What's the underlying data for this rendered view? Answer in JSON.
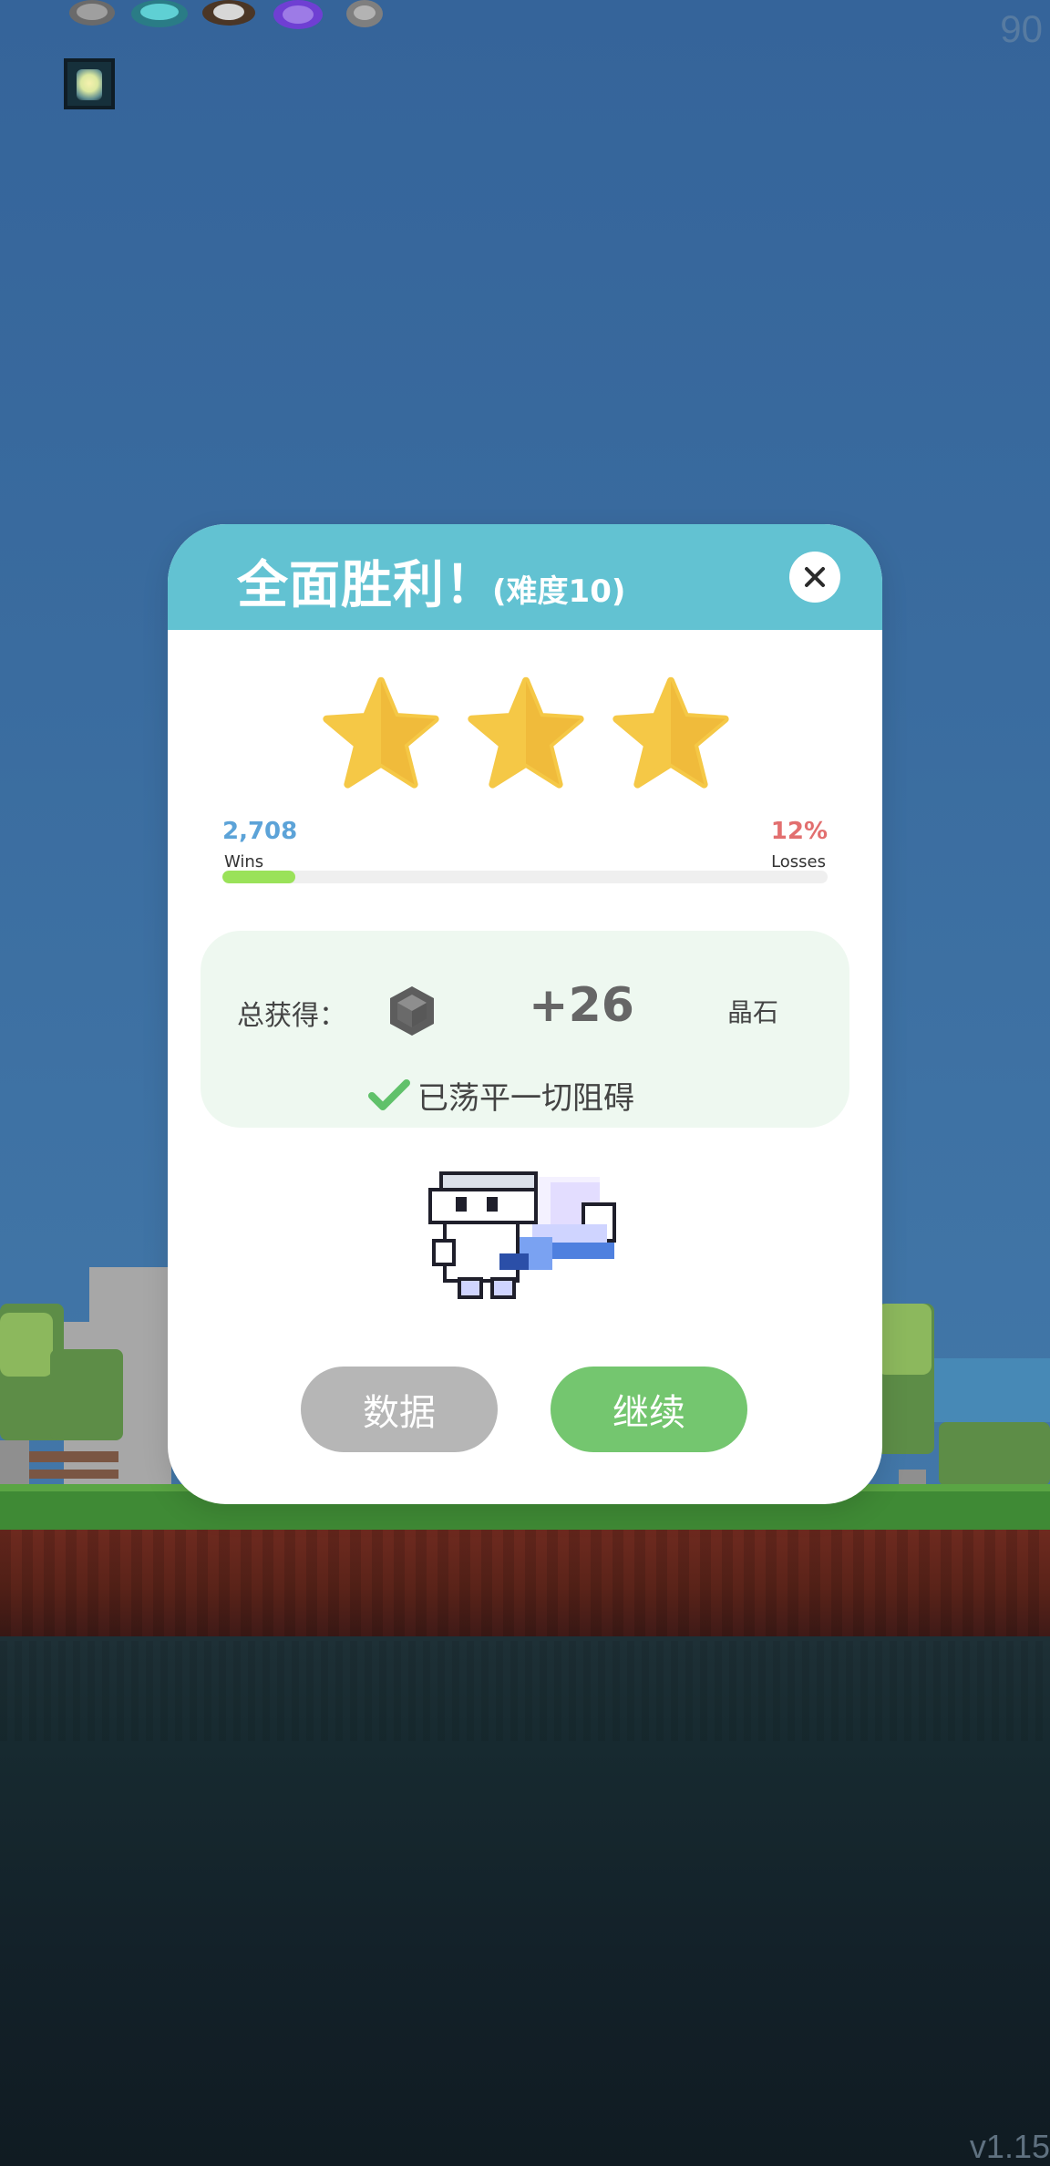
{
  "hud": {
    "fps": "90",
    "version": "v1.15",
    "top_icons": [
      "helmet-icon",
      "shield-icon",
      "boot-icon",
      "potion-icon",
      "lamp-icon"
    ],
    "tile_icon": "lantern-icon"
  },
  "modal": {
    "title": "全面胜利！",
    "difficulty": "(难度10)",
    "stars": 3,
    "stats": {
      "wins_count": "2,708",
      "wins_label": "Wins",
      "loss_percent": "12%",
      "loss_label": "Losses",
      "progress_fraction": 0.12
    },
    "reward": {
      "label": "总获得：",
      "value": "+26",
      "unit": "晶石",
      "icon": "gem-icon"
    },
    "clear_message": "已荡平一切阻碍",
    "buttons": {
      "stats": "数据",
      "continue": "继续"
    },
    "colors": {
      "header": "#62c2d2",
      "stats_button": "#b6b6b6",
      "continue_button": "#74c66f",
      "star": "#f5c846",
      "wins": "#5ca3d8",
      "losses": "#e26f6f",
      "progress": "#9ae259"
    }
  }
}
